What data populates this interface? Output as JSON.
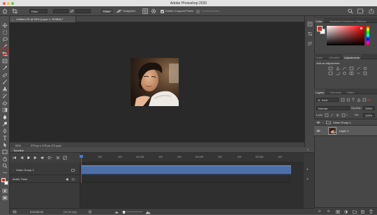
{
  "app_title": "Adobe Photoshop 2020",
  "options_bar": {
    "ratio_label": "Ratio",
    "clear_label": "Clear",
    "straighten_label": "Straighten",
    "delete_cropped_label": "Delete Cropped Pixels",
    "content_aware_label": "Content-Aware"
  },
  "document": {
    "tab_title": "Untitled-25 @ 50% (Layer 1, RGB/8) *",
    "zoom": "50%",
    "doc_info": "375 px x 375 px (72 ppi)"
  },
  "timeline": {
    "panel_title": "Timeline",
    "ruler_labels": [
      "10f",
      "20f",
      "01:00f",
      "10f",
      "20f",
      "02:00f",
      "10f",
      "20f",
      "03:00f",
      "10f"
    ],
    "tracks": {
      "video_group": "Video Group 1",
      "audio_track": "Audio Track"
    },
    "timecode": "0:00:00:00",
    "fps": "(30.00 fps)"
  },
  "panels": {
    "color_tabs": [
      "Color",
      "Swatches",
      "Gradients",
      "Patterns"
    ],
    "adjust_tabs": [
      "Learn",
      "Libraries",
      "Adjustments"
    ],
    "adjust_label": "Add an adjustment",
    "layers_tabs": [
      "Layers",
      "Channels",
      "Paths"
    ],
    "kind_label": "Kind",
    "blend_mode": "Normal",
    "opacity_label": "Opacity:",
    "opacity_value": "100%",
    "lock_label": "Lock:",
    "fill_label": "Fill:",
    "fill_value": "100%",
    "layers": [
      {
        "name": "Video Group 1"
      },
      {
        "name": "Layer 1"
      }
    ]
  },
  "colors": {
    "foreground": "#c8321e",
    "background": "#ffffff",
    "accent_blue": "#4d6fa8",
    "annotation_red": "#d11f1f"
  }
}
